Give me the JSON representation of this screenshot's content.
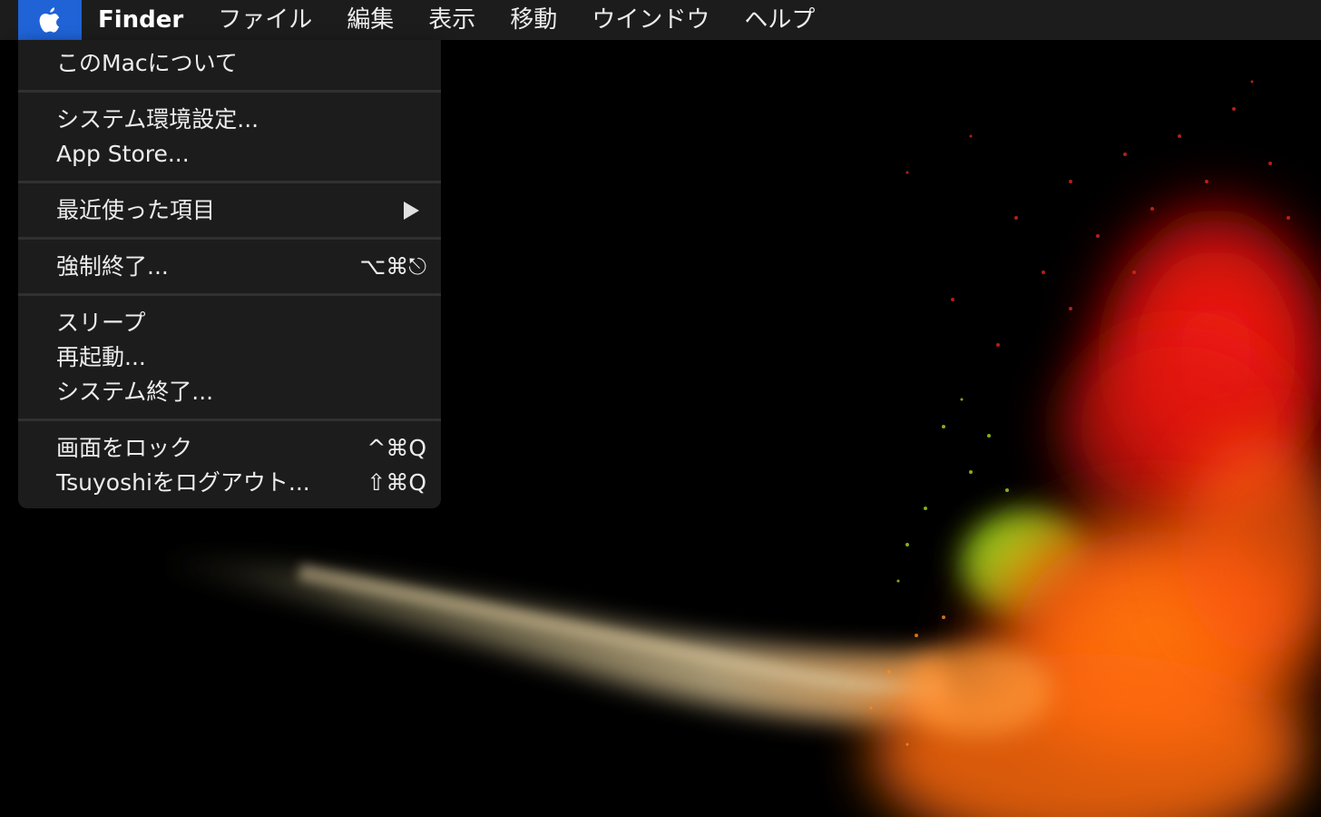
{
  "menubar": {
    "apple_icon": "apple-logo-icon",
    "app_name": "Finder",
    "items": [
      "ファイル",
      "編集",
      "表示",
      "移動",
      "ウインドウ",
      "ヘルプ"
    ]
  },
  "apple_menu": {
    "about": "このMacについて",
    "system_prefs": "システム環境設定...",
    "app_store": "App Store...",
    "recent_items": "最近使った項目",
    "force_quit": "強制終了...",
    "force_quit_shortcut": "⌥⌘⎋",
    "sleep": "スリープ",
    "restart": "再起動...",
    "shutdown": "システム終了...",
    "lock_screen": "画面をロック",
    "lock_screen_shortcut": "^⌘Q",
    "logout": "Tsuyoshiをログアウト...",
    "logout_shortcut": "⇧⌘Q"
  },
  "colors": {
    "menubar_bg": "#1c1c1c",
    "apple_highlight": "#1f63d6",
    "menu_bg": "#1c1c1c",
    "separator": "#303030",
    "text": "#ececec"
  }
}
